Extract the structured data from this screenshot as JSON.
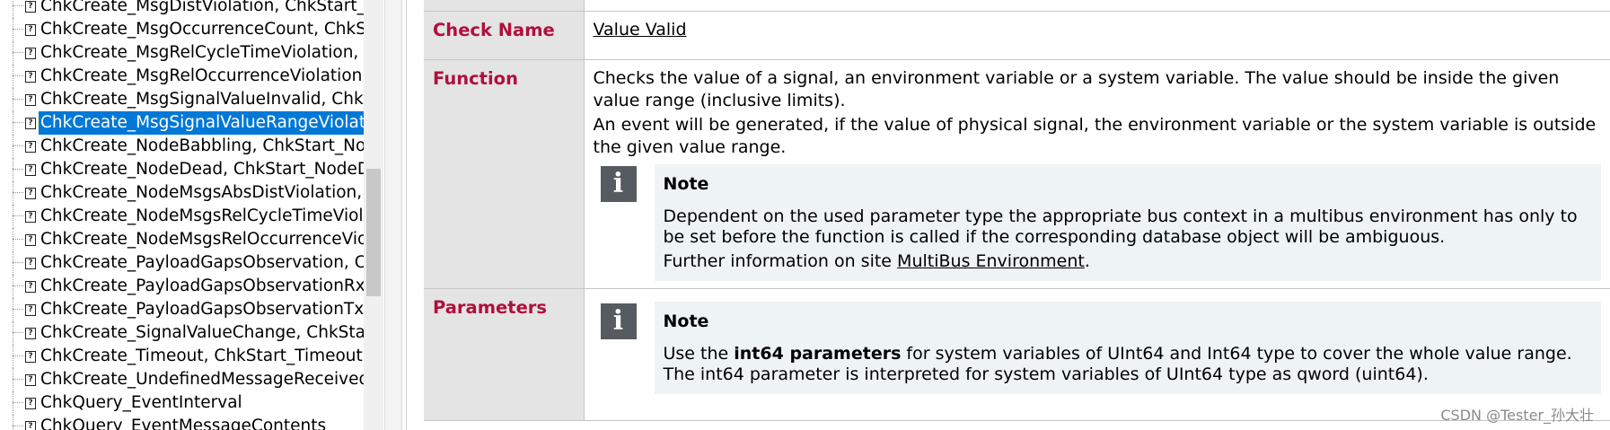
{
  "tree": {
    "items": [
      {
        "label": "ChkCreate_MsgDistViolation, ChkStart_Ms",
        "selected": false
      },
      {
        "label": "ChkCreate_MsgOccurrenceCount, ChkStar",
        "selected": false
      },
      {
        "label": "ChkCreate_MsgRelCycleTimeViolation, Ch",
        "selected": false
      },
      {
        "label": "ChkCreate_MsgRelOccurrenceViolation, C",
        "selected": false
      },
      {
        "label": "ChkCreate_MsgSignalValueInvalid, ChkSta",
        "selected": false
      },
      {
        "label": "ChkCreate_MsgSignalValueRangeViolatio",
        "selected": true
      },
      {
        "label": "ChkCreate_NodeBabbling, ChkStart_Node",
        "selected": false
      },
      {
        "label": "ChkCreate_NodeDead, ChkStart_NodeDea",
        "selected": false
      },
      {
        "label": "ChkCreate_NodeMsgsAbsDistViolation, C",
        "selected": false
      },
      {
        "label": "ChkCreate_NodeMsgsRelCycleTimeViolat",
        "selected": false
      },
      {
        "label": "ChkCreate_NodeMsgsRelOccurrenceViola",
        "selected": false
      },
      {
        "label": "ChkCreate_PayloadGapsObservation, Chk",
        "selected": false
      },
      {
        "label": "ChkCreate_PayloadGapsObservationRx, C",
        "selected": false
      },
      {
        "label": "ChkCreate_PayloadGapsObservationTx, Cl",
        "selected": false
      },
      {
        "label": "ChkCreate_SignalValueChange, ChkStart_",
        "selected": false
      },
      {
        "label": "ChkCreate_Timeout, ChkStart_Timeout",
        "selected": false
      },
      {
        "label": "ChkCreate_UndefinedMessageReceived, C",
        "selected": false
      },
      {
        "label": "ChkQuery_EventInterval",
        "selected": false
      },
      {
        "label": "ChkQuery_EventMessageContents",
        "selected": false
      }
    ]
  },
  "doc": {
    "check_name": {
      "label": "Check Name",
      "value": "Value Valid"
    },
    "function": {
      "label": "Function",
      "para1": "Checks the value of a signal, an environment variable or a system variable. The value should be inside the given value range (inclusive limits).",
      "para2": "An event will be generated, if the value of physical signal, the environment variable or the system variable is outside the given value range.",
      "note": {
        "title": "Note",
        "text1": "Dependent on the used parameter type the appropriate bus context in a multibus environment has only to be set before the function is called if the corresponding database object will be ambiguous.",
        "text2_prefix": "Further information on site ",
        "text2_link": "MultiBus Environment",
        "text2_suffix": "."
      }
    },
    "parameters": {
      "label": "Parameters",
      "note": {
        "title": "Note",
        "text_prefix": "Use the ",
        "text_bold": "int64 parameters",
        "text_suffix": " for system variables of UInt64 and Int64 type to cover the whole value range. The int64 parameter is interpreted for system variables of UInt64 type as qword (uint64)."
      }
    }
  },
  "watermark": "CSDN @Tester_孙大壮",
  "colors": {
    "label_text": "#b0103a",
    "label_bg": "#e4e4e4",
    "selection": "#0078d7",
    "note_bg": "#eef3f4",
    "info_icon_bg": "#555b60"
  },
  "icons": {
    "tree_item": "help-page-icon",
    "note": "info-icon"
  }
}
